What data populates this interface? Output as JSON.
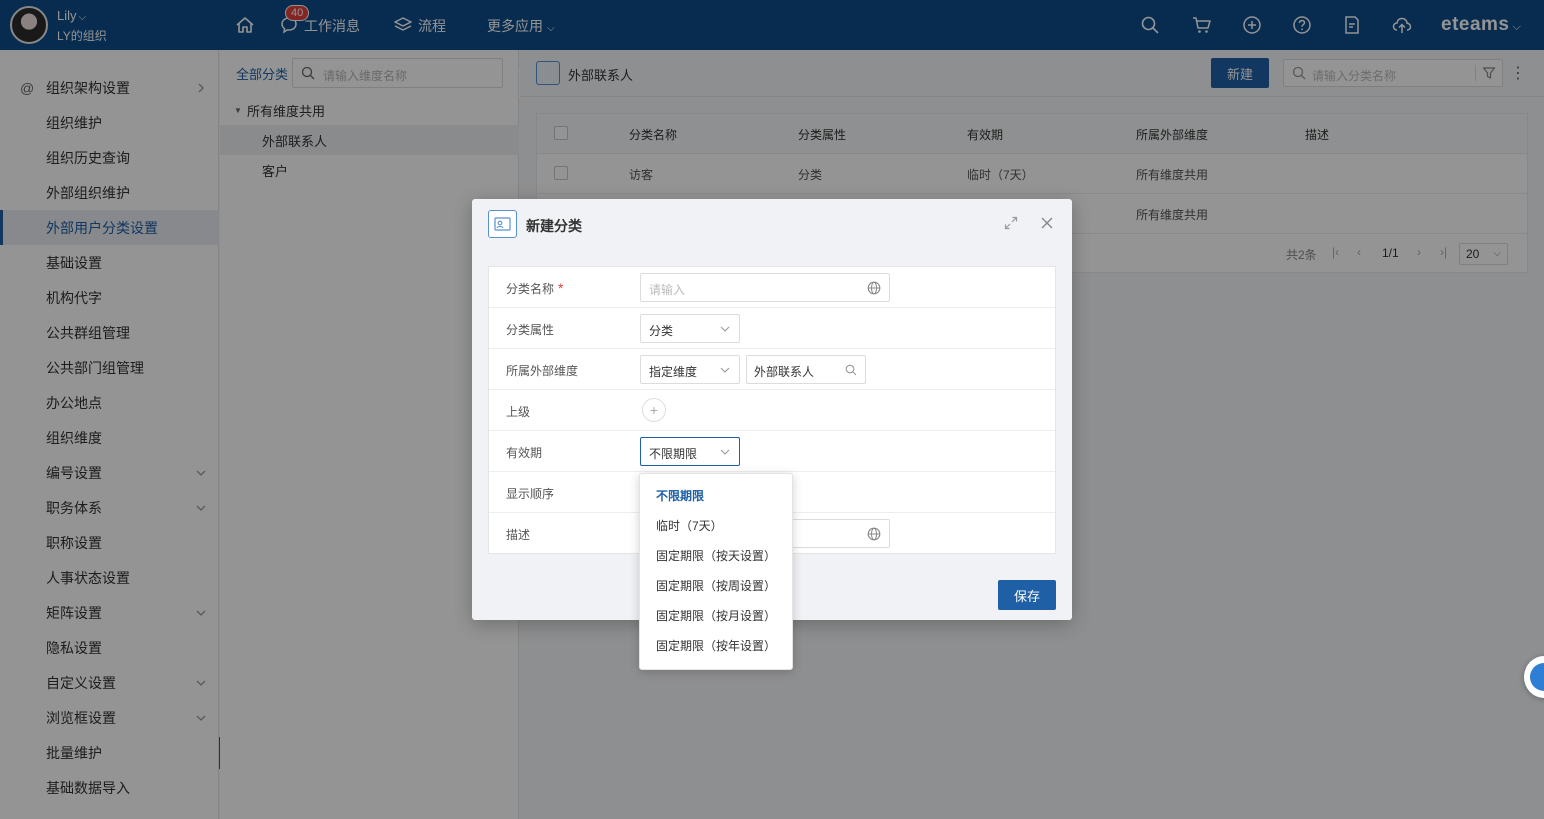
{
  "user": {
    "name": "Lily",
    "org": "LY的组织"
  },
  "topnav": {
    "badge": "40",
    "items": [
      "工作消息",
      "流程",
      "更多应用"
    ],
    "brand": "eteams"
  },
  "sidebar": {
    "items": [
      {
        "label": "组织架构设置"
      },
      {
        "label": "组织维护"
      },
      {
        "label": "组织历史查询"
      },
      {
        "label": "外部组织维护"
      },
      {
        "label": "外部用户分类设置"
      },
      {
        "label": "基础设置"
      },
      {
        "label": "机构代字"
      },
      {
        "label": "公共群组管理"
      },
      {
        "label": "公共部门组管理"
      },
      {
        "label": "办公地点"
      },
      {
        "label": "组织维度"
      },
      {
        "label": "编号设置"
      },
      {
        "label": "职务体系"
      },
      {
        "label": "职称设置"
      },
      {
        "label": "人事状态设置"
      },
      {
        "label": "矩阵设置"
      },
      {
        "label": "隐私设置"
      },
      {
        "label": "自定义设置"
      },
      {
        "label": "浏览框设置"
      },
      {
        "label": "批量维护"
      },
      {
        "label": "基础数据导入"
      }
    ]
  },
  "tree": {
    "title": "全部分类",
    "search_placeholder": "请输入维度名称",
    "root": "所有维度共用",
    "children": [
      "外部联系人",
      "客户"
    ]
  },
  "main": {
    "title": "外部联系人",
    "new_button": "新建",
    "search_placeholder": "请输入分类名称",
    "columns": [
      "分类名称",
      "分类属性",
      "有效期",
      "所属外部维度",
      "描述"
    ],
    "rows": [
      {
        "name": "访客",
        "attr": "分类",
        "validity": "临时（7天）",
        "dimension": "所有维度共用",
        "desc": ""
      },
      {
        "name": "",
        "attr": "",
        "validity": "",
        "dimension": "所有维度共用",
        "desc": ""
      }
    ],
    "pager": {
      "total": "共2条",
      "page": "1/1",
      "size": "20"
    }
  },
  "dialog": {
    "title": "新建分类",
    "fields": {
      "name_label": "分类名称",
      "name_placeholder": "请输入",
      "attr_label": "分类属性",
      "attr_value": "分类",
      "dimension_label": "所属外部维度",
      "dimension_mode": "指定维度",
      "dimension_value": "外部联系人",
      "parent_label": "上级",
      "validity_label": "有效期",
      "validity_value": "不限期限",
      "order_label": "显示顺序",
      "desc_label": "描述"
    },
    "save_button": "保存"
  },
  "dropdown": {
    "options": [
      "不限期限",
      "临时（7天）",
      "固定期限（按天设置）",
      "固定期限（按周设置）",
      "固定期限（按月设置）",
      "固定期限（按年设置）"
    ]
  },
  "colors": {
    "primary": "#1f5fa5",
    "topbar": "#0d4c8b",
    "badge": "#e2403b"
  }
}
